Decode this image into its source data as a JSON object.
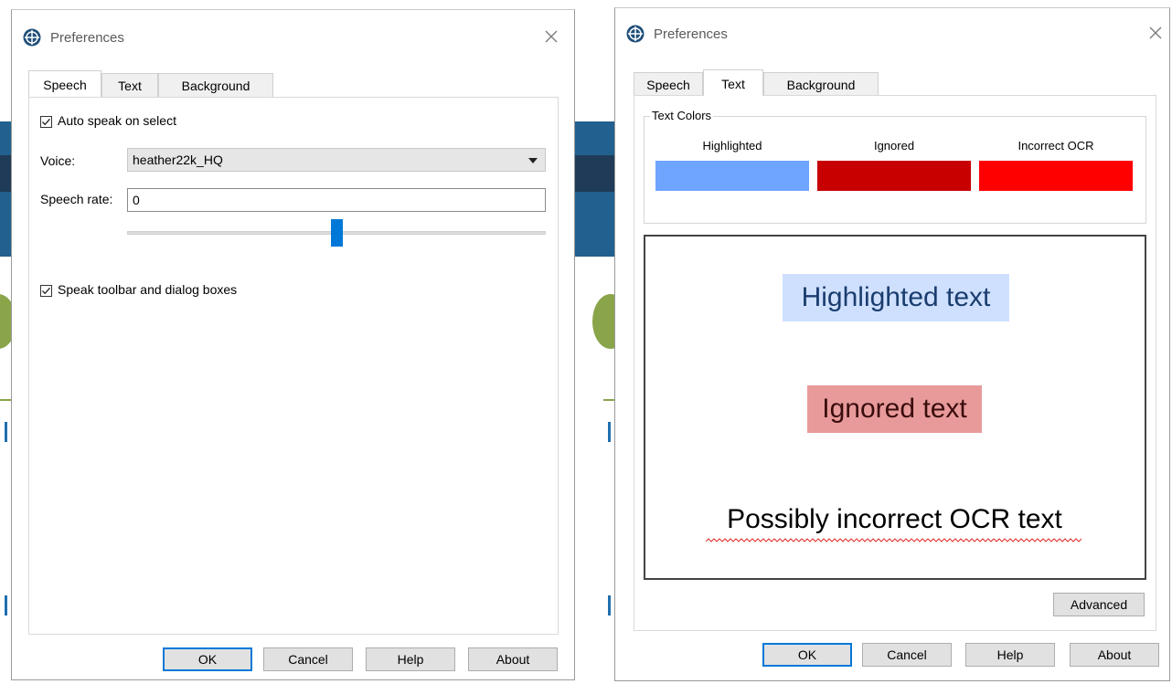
{
  "colors": {
    "accent": "#0078d7",
    "highlighted": "#6fa4ff",
    "ignored": "#c80000",
    "incorrect_ocr": "#ff0000",
    "highlighted_preview_bg": "#cfe0ff",
    "ignored_preview_bg": "#e89a9a"
  },
  "left_dialog": {
    "title": "Preferences",
    "tabs": [
      {
        "label": "Speech",
        "active": true
      },
      {
        "label": "Text",
        "active": false
      },
      {
        "label": "Background",
        "active": false
      }
    ],
    "speech": {
      "auto_speak_label": "Auto speak on select",
      "auto_speak_checked": true,
      "voice_label": "Voice:",
      "voice_value": "heather22k_HQ",
      "rate_label": "Speech rate:",
      "rate_value": "0",
      "speak_toolbar_label": "Speak toolbar and dialog boxes",
      "speak_toolbar_checked": true
    },
    "buttons": {
      "ok": "OK",
      "cancel": "Cancel",
      "help": "Help",
      "about": "About"
    }
  },
  "right_dialog": {
    "title": "Preferences",
    "tabs": [
      {
        "label": "Speech",
        "active": false
      },
      {
        "label": "Text",
        "active": true
      },
      {
        "label": "Background",
        "active": false
      }
    ],
    "text_colors": {
      "legend": "Text Colors",
      "highlighted_label": "Highlighted",
      "ignored_label": "Ignored",
      "incorrect_label": "Incorrect OCR"
    },
    "preview": {
      "highlighted_text": "Highlighted text",
      "ignored_text": "Ignored text",
      "incorrect_text": "Possibly incorrect OCR text"
    },
    "advanced_label": "Advanced",
    "buttons": {
      "ok": "OK",
      "cancel": "Cancel",
      "help": "Help",
      "about": "About"
    }
  },
  "icons": {
    "app": "globe-icon",
    "close": "close-icon",
    "dropdown": "chevron-down-icon",
    "check": "checkmark-icon"
  }
}
